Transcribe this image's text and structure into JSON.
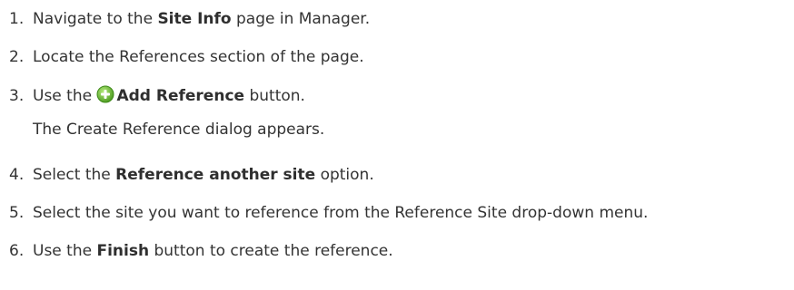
{
  "steps": [
    {
      "num": "1.",
      "before": "Navigate to the ",
      "bold": "Site Info",
      "after": " page in Manager."
    },
    {
      "num": "2.",
      "text": "Locate the References section of the page."
    },
    {
      "num": "3.",
      "before": "Use the ",
      "bold": "Add Reference",
      "after": " button.",
      "note": "The Create Reference dialog appears.",
      "icon": "add-icon"
    },
    {
      "num": "4.",
      "before": "Select the ",
      "bold": "Reference another site",
      "after": " option."
    },
    {
      "num": "5.",
      "text": "Select the site you want to reference from the Reference Site drop-down menu."
    },
    {
      "num": "6.",
      "before": "Use the ",
      "bold": "Finish",
      "after": " button to create the reference."
    }
  ],
  "colors": {
    "text": "#333333",
    "icon_green": "#6dbb3a"
  }
}
